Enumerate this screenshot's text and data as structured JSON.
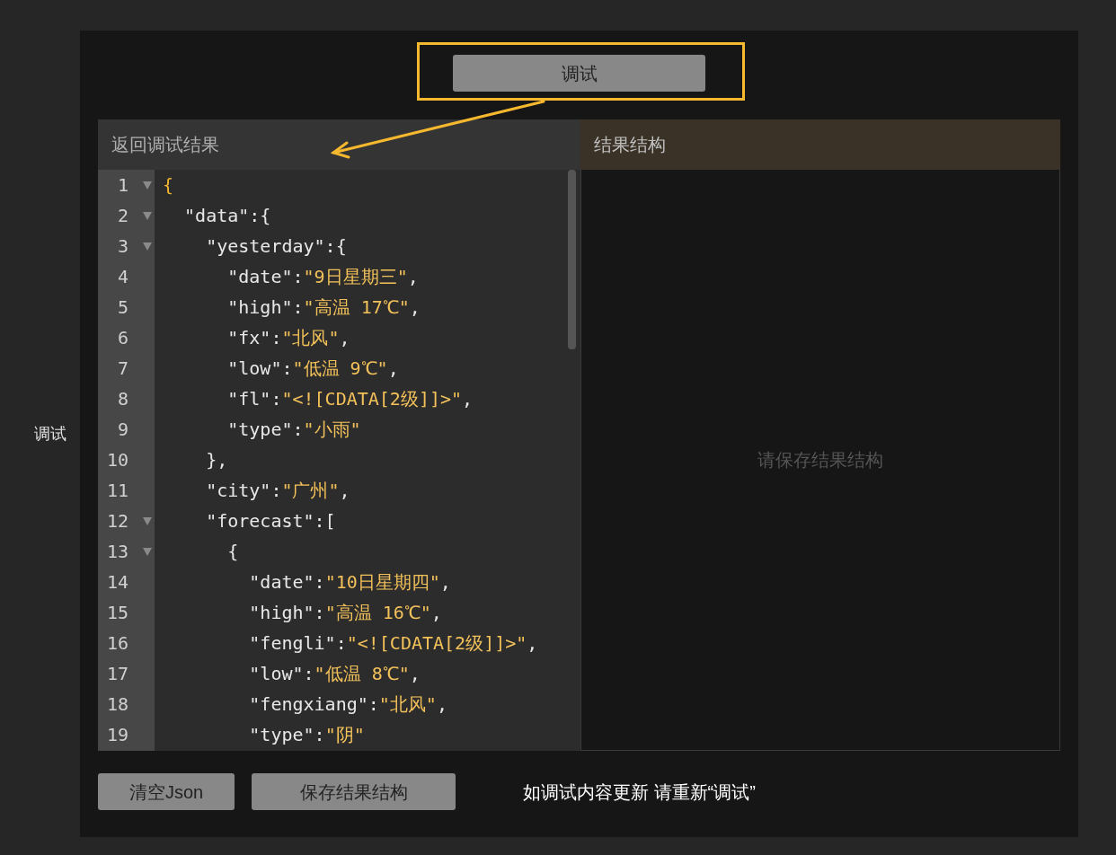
{
  "side_label": "调试",
  "debug_button": "调试",
  "left_panel": {
    "title": "返回调试结果",
    "lines": [
      {
        "number": "1",
        "foldable": true,
        "segments": [
          {
            "kind": "accent",
            "text": "{"
          }
        ]
      },
      {
        "number": "2",
        "foldable": true,
        "segments": [
          {
            "kind": "plain",
            "text": "  \"data\":{"
          }
        ]
      },
      {
        "number": "3",
        "foldable": true,
        "segments": [
          {
            "kind": "plain",
            "text": "    \"yesterday\":{"
          }
        ]
      },
      {
        "number": "4",
        "foldable": false,
        "segments": [
          {
            "kind": "plain",
            "text": "      \"date\":"
          },
          {
            "kind": "string",
            "text": "\"9日星期三\""
          },
          {
            "kind": "plain",
            "text": ","
          }
        ]
      },
      {
        "number": "5",
        "foldable": false,
        "segments": [
          {
            "kind": "plain",
            "text": "      \"high\":"
          },
          {
            "kind": "string",
            "text": "\"高温 17℃\""
          },
          {
            "kind": "plain",
            "text": ","
          }
        ]
      },
      {
        "number": "6",
        "foldable": false,
        "segments": [
          {
            "kind": "plain",
            "text": "      \"fx\":"
          },
          {
            "kind": "string",
            "text": "\"北风\""
          },
          {
            "kind": "plain",
            "text": ","
          }
        ]
      },
      {
        "number": "7",
        "foldable": false,
        "segments": [
          {
            "kind": "plain",
            "text": "      \"low\":"
          },
          {
            "kind": "string",
            "text": "\"低温 9℃\""
          },
          {
            "kind": "plain",
            "text": ","
          }
        ]
      },
      {
        "number": "8",
        "foldable": false,
        "segments": [
          {
            "kind": "plain",
            "text": "      \"fl\":"
          },
          {
            "kind": "string",
            "text": "\"<![CDATA[2级]]>\""
          },
          {
            "kind": "plain",
            "text": ","
          }
        ]
      },
      {
        "number": "9",
        "foldable": false,
        "segments": [
          {
            "kind": "plain",
            "text": "      \"type\":"
          },
          {
            "kind": "string",
            "text": "\"小雨\""
          }
        ]
      },
      {
        "number": "10",
        "foldable": false,
        "segments": [
          {
            "kind": "plain",
            "text": "    },"
          }
        ]
      },
      {
        "number": "11",
        "foldable": false,
        "segments": [
          {
            "kind": "plain",
            "text": "    \"city\":"
          },
          {
            "kind": "string",
            "text": "\"广州\""
          },
          {
            "kind": "plain",
            "text": ","
          }
        ]
      },
      {
        "number": "12",
        "foldable": true,
        "segments": [
          {
            "kind": "plain",
            "text": "    \"forecast\":["
          }
        ]
      },
      {
        "number": "13",
        "foldable": true,
        "segments": [
          {
            "kind": "plain",
            "text": "      {"
          }
        ]
      },
      {
        "number": "14",
        "foldable": false,
        "segments": [
          {
            "kind": "plain",
            "text": "        \"date\":"
          },
          {
            "kind": "string",
            "text": "\"10日星期四\""
          },
          {
            "kind": "plain",
            "text": ","
          }
        ]
      },
      {
        "number": "15",
        "foldable": false,
        "segments": [
          {
            "kind": "plain",
            "text": "        \"high\":"
          },
          {
            "kind": "string",
            "text": "\"高温 16℃\""
          },
          {
            "kind": "plain",
            "text": ","
          }
        ]
      },
      {
        "number": "16",
        "foldable": false,
        "segments": [
          {
            "kind": "plain",
            "text": "        \"fengli\":"
          },
          {
            "kind": "string",
            "text": "\"<![CDATA[2级]]>\""
          },
          {
            "kind": "plain",
            "text": ","
          }
        ]
      },
      {
        "number": "17",
        "foldable": false,
        "segments": [
          {
            "kind": "plain",
            "text": "        \"low\":"
          },
          {
            "kind": "string",
            "text": "\"低温 8℃\""
          },
          {
            "kind": "plain",
            "text": ","
          }
        ]
      },
      {
        "number": "18",
        "foldable": false,
        "segments": [
          {
            "kind": "plain",
            "text": "        \"fengxiang\":"
          },
          {
            "kind": "string",
            "text": "\"北风\""
          },
          {
            "kind": "plain",
            "text": ","
          }
        ]
      },
      {
        "number": "19",
        "foldable": false,
        "segments": [
          {
            "kind": "plain",
            "text": "        \"type\":"
          },
          {
            "kind": "string",
            "text": "\"阴\""
          }
        ]
      }
    ]
  },
  "right_panel": {
    "title": "结果结构",
    "placeholder": "请保存结果结构"
  },
  "buttons": [
    "清空Json",
    "保存结果结构"
  ],
  "hint": "如调试内容更新 请重新“调试”"
}
